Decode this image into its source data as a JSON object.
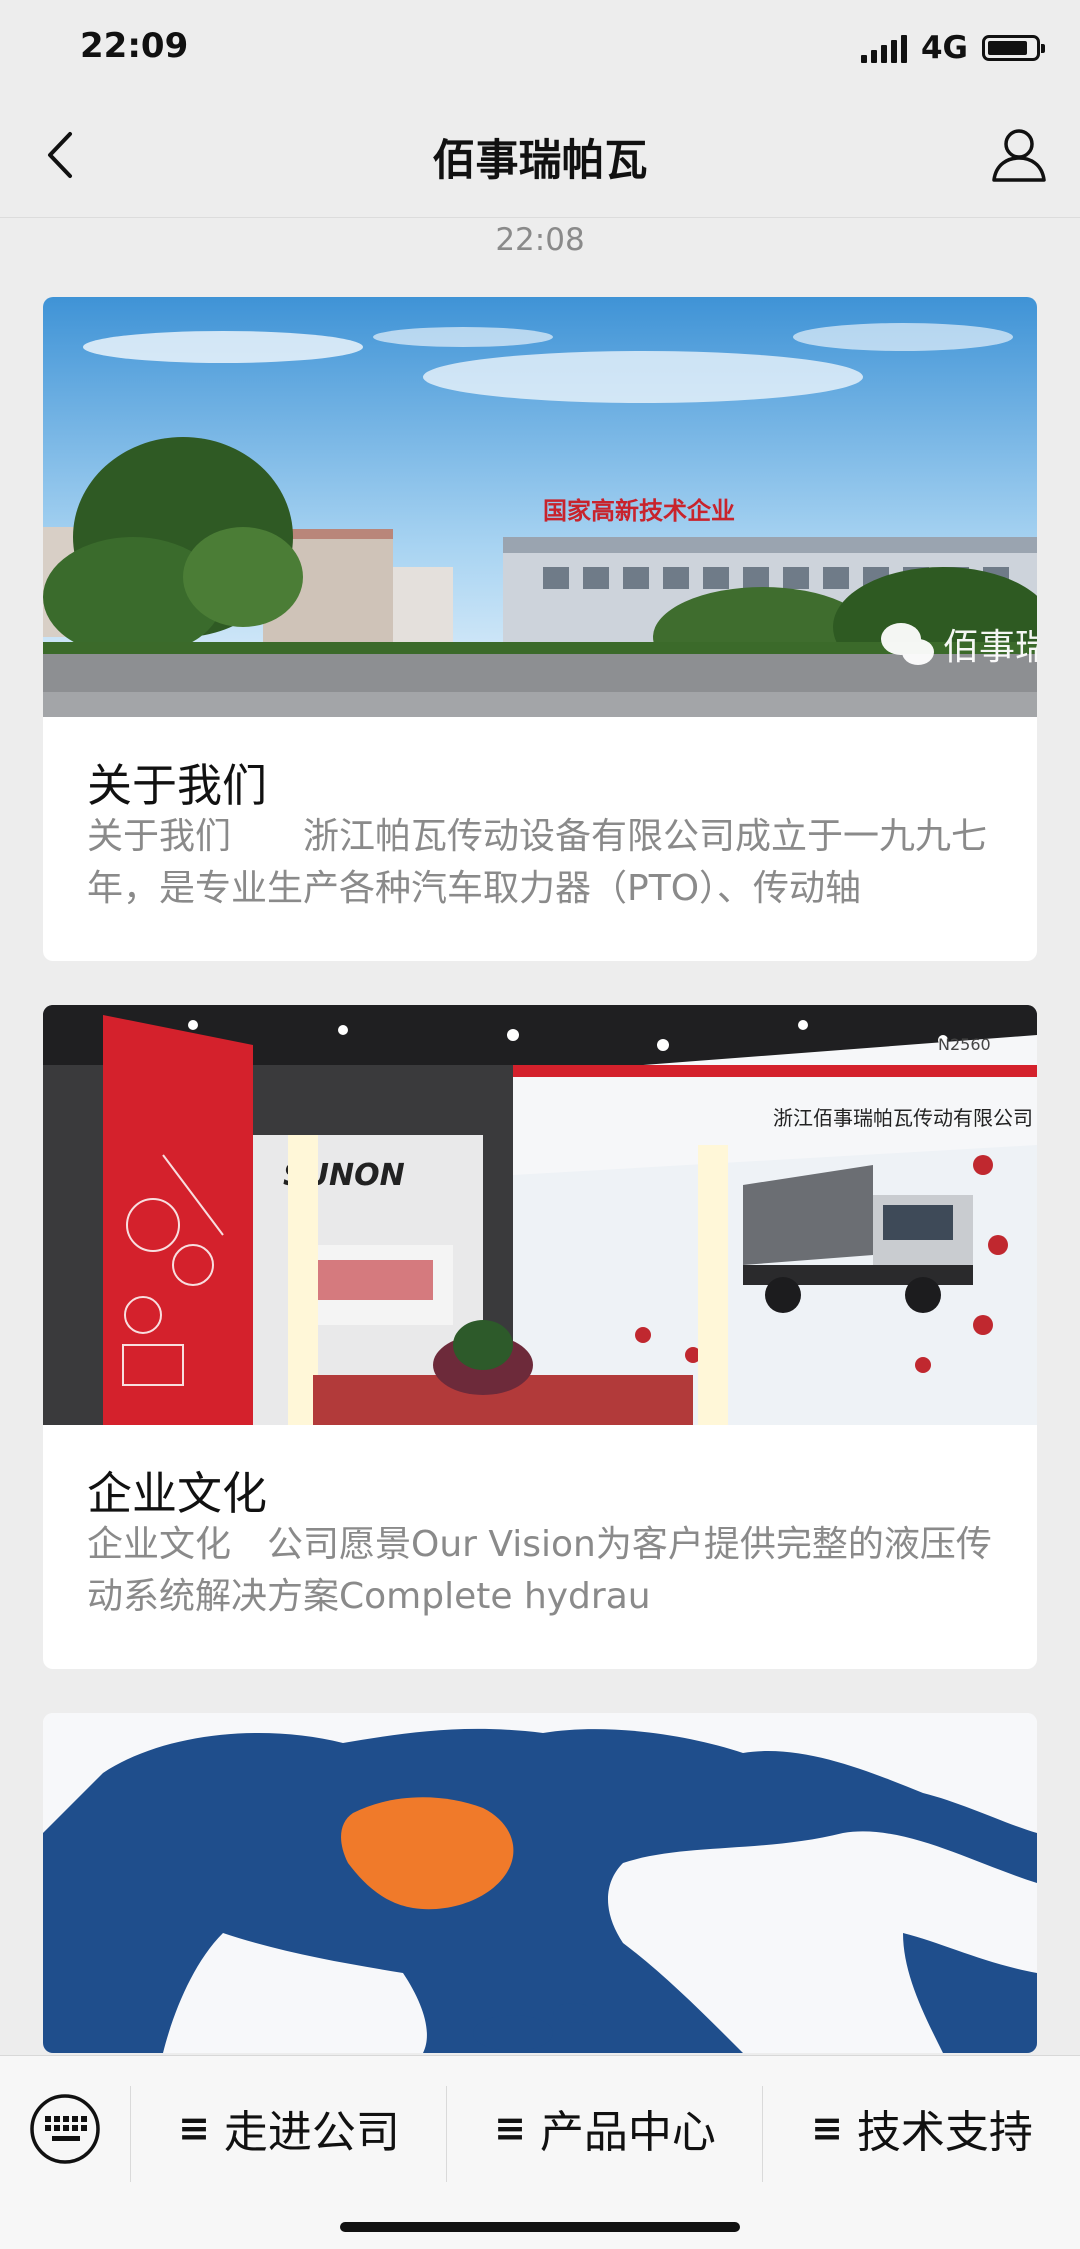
{
  "status_bar": {
    "time": "22:09",
    "network": "4G",
    "battery_level": 0.85
  },
  "nav": {
    "title": "佰事瑞帕瓦",
    "back_icon": "chevron-left-icon",
    "profile_icon": "user-icon"
  },
  "chat": {
    "timestamp": "22:08"
  },
  "cards": [
    {
      "title": "关于我们",
      "description": "关于我们　　浙江帕瓦传动设备有限公司成立于一九九七年，是专业生产各种汽车取力器（PTO）、传动轴",
      "image": {
        "sign_text": "国家高新技术企业",
        "watermark": "佰事瑞"
      }
    },
    {
      "title": "企业文化",
      "description": "企业文化　公司愿景Our Vision为客户提供完整的液压传动系统解决方案Complete hydrau",
      "image": {
        "left_booth_logo": "SUNON",
        "banner_text": "浙江佰事瑞帕瓦传动有限公司",
        "booth_number": "N2560"
      }
    },
    {
      "title": "",
      "description": "",
      "image": {
        "subject": "world-map"
      }
    }
  ],
  "bottom_menu": {
    "keyboard_icon": "keyboard-icon",
    "items": [
      {
        "label": "走进公司",
        "icon": "menu-icon"
      },
      {
        "label": "产品中心",
        "icon": "menu-icon"
      },
      {
        "label": "技术支持",
        "icon": "menu-icon"
      }
    ]
  }
}
